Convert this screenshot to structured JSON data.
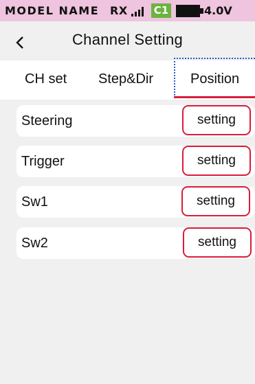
{
  "status_bar": {
    "model_name": "MODEL NAME",
    "rx_label": "RX",
    "signal_icon": "signal-bars-icon",
    "channel_badge": "C1",
    "battery_icon": "battery-icon",
    "voltage": "4.0V",
    "background_color": "#eec4de",
    "badge_color": "#6db33f"
  },
  "header": {
    "back_icon": "chevron-left-icon",
    "title": "Channel Setting"
  },
  "tabs": [
    {
      "label": "CH set",
      "active": false
    },
    {
      "label": "Step&Dir",
      "active": false
    },
    {
      "label": "Position",
      "active": true
    }
  ],
  "accent_color": "#d91c3a",
  "focus_color": "#2e56c9",
  "channels": [
    {
      "label": "Steering",
      "button": "setting"
    },
    {
      "label": "Trigger",
      "button": "setting"
    },
    {
      "label": "Sw1",
      "button": "setting"
    },
    {
      "label": "Sw2",
      "button": "setting"
    }
  ]
}
